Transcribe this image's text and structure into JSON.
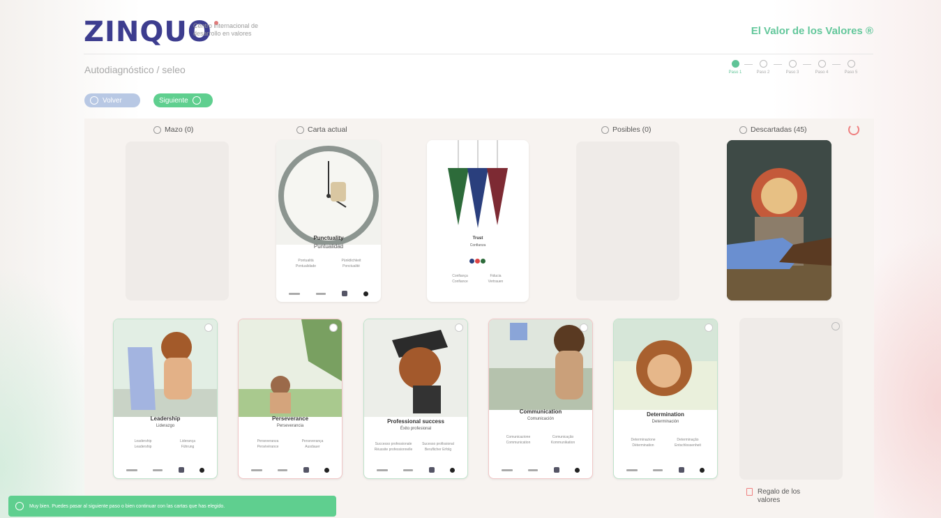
{
  "brand": {
    "logo": "ZINQUO",
    "tagline": "Centro internacional de desarrollo en valores"
  },
  "app_title": "El Valor de los Valores ®",
  "breadcrumb": "Autodiagnóstico / seleo",
  "stepper": {
    "steps": [
      {
        "label": "Paso 1",
        "active": true
      },
      {
        "label": "Paso 2",
        "active": false
      },
      {
        "label": "Paso 3",
        "active": false
      },
      {
        "label": "Paso 4",
        "active": false
      },
      {
        "label": "Paso 5",
        "active": false
      }
    ]
  },
  "buttons": {
    "back": "Volver",
    "next": "Siguiente"
  },
  "columns": {
    "mazo": "Mazo (0)",
    "current": "Carta actual",
    "possibles": "Posibles (0)",
    "discarded": "Descartadas (45)"
  },
  "current_card": {
    "title": "Punctuality",
    "subtitle": "Puntualidad",
    "translations": [
      "Pontualità",
      "Pünktlichkeit",
      "Pontualidade",
      "Ponctualité"
    ]
  },
  "trust_card": {
    "title": "Trust",
    "subtitle": "Confianza",
    "translations": [
      "Confiança",
      "Fiducia",
      "Confiance",
      "Vertrauen"
    ]
  },
  "hand_cards": [
    {
      "title": "Leadership",
      "subtitle": "Liderazgo",
      "translations": [
        "Leadership",
        "Liderança",
        "Leadership",
        "Führung"
      ]
    },
    {
      "title": "Perseverance",
      "subtitle": "Perseverancia",
      "translations": [
        "Perseveranza",
        "Perseverança",
        "Persévérance",
        "Ausdauer"
      ]
    },
    {
      "title": "Professional success",
      "subtitle": "Éxito profesional",
      "translations": [
        "Successo professionale",
        "Sucesso profissional",
        "Réussite professionnelle",
        "Beruflicher Erfolg"
      ]
    },
    {
      "title": "Communication",
      "subtitle": "Comunicación",
      "translations": [
        "Comunicazione",
        "Comunicação",
        "Communication",
        "Kommunikation"
      ]
    },
    {
      "title": "Determination",
      "subtitle": "Determinación",
      "translations": [
        "Determinazione",
        "Determinação",
        "Détermination",
        "Entschlossenheit"
      ]
    }
  ],
  "gift": "Regalo de los valores",
  "toast": "Muy bien. Puedes pasar al siguiente paso o bien continuar con las cartas que has elegido.",
  "colors": {
    "brand_green": "#5fcf8f",
    "brand_blue": "#3d3d8f",
    "accent_red": "#ef7f7f"
  }
}
